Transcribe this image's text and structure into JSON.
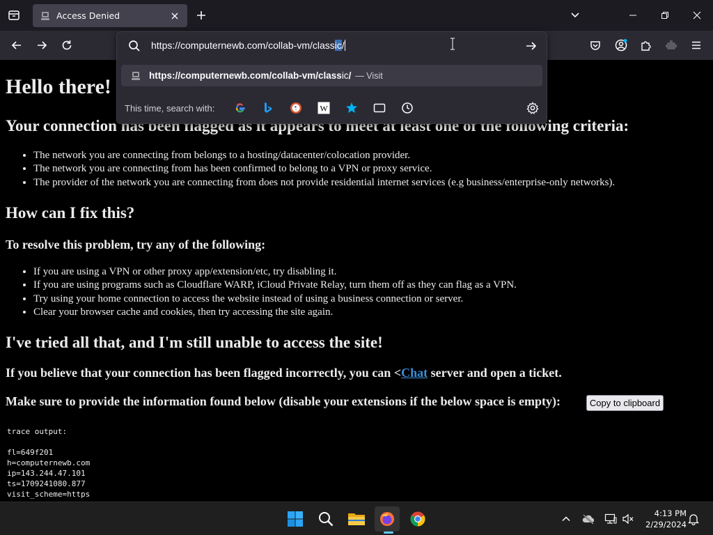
{
  "browser": {
    "tab": {
      "title": "Access Denied"
    },
    "url": {
      "prefix": "https://computernewb.com/collab-vm/class",
      "selected": "ic",
      "suffix": "/"
    },
    "suggestion": {
      "url_bold": "https://computernewb.com/collab-vm/class",
      "url_plain": "ic",
      "url_tail": "/",
      "action": "— Visit"
    },
    "search_with_label": "This time, search with:",
    "search_engines": [
      "google-icon",
      "bing-icon",
      "duckduckgo-icon",
      "wikipedia-icon",
      "bookmarks-icon",
      "tabs-icon",
      "history-icon"
    ]
  },
  "page": {
    "heading": "Hello there!",
    "criteria_heading": "Your connection has been flagged as it appears to meet at least one of the following criteria:",
    "criteria": [
      "The network you are connecting from belongs to a hosting/datacenter/colocation provider.",
      "The network you are connecting from has been confirmed to belong to a VPN or proxy service.",
      "The provider of the network you are connecting from does not provide residential internet services (e.g business/enterprise-only networks)."
    ],
    "fix_heading": "How can I fix this?",
    "resolve_heading": "To resolve this problem, try any of the following:",
    "fixes": [
      "If you are using a VPN or other proxy app/extension/etc, try disabling it.",
      "If you are using programs such as Cloudflare WARP, iCloud Private Relay, turn them off as they can flag as a VPN.",
      "Try using your home connection to access the website instead of using a business connection or server.",
      "Clear your browser cache and cookies, then try accessing the site again."
    ],
    "tried_heading": "I've tried all that, and I'm still unable to access the site!",
    "flagged_before": "If you believe that your connection has been flagged incorrectly, you can <",
    "flagged_link": "Chat",
    "flagged_after": " server and open a ticket.",
    "provide_info": "Make sure to provide the information found below (disable your extensions if the below space is empty):",
    "copy_button": "Copy to clipboard",
    "trace": "trace output:\n\nfl=649f201\nh=computernewb.com\nip=143.244.47.101\nts=1709241080.877\nvisit_scheme=https"
  },
  "taskbar": {
    "time": "4:13 PM",
    "date": "2/29/2024"
  },
  "colors": {
    "link": "#3d8ed8",
    "selection": "#3a6fb5",
    "accent": "#60cdff"
  }
}
